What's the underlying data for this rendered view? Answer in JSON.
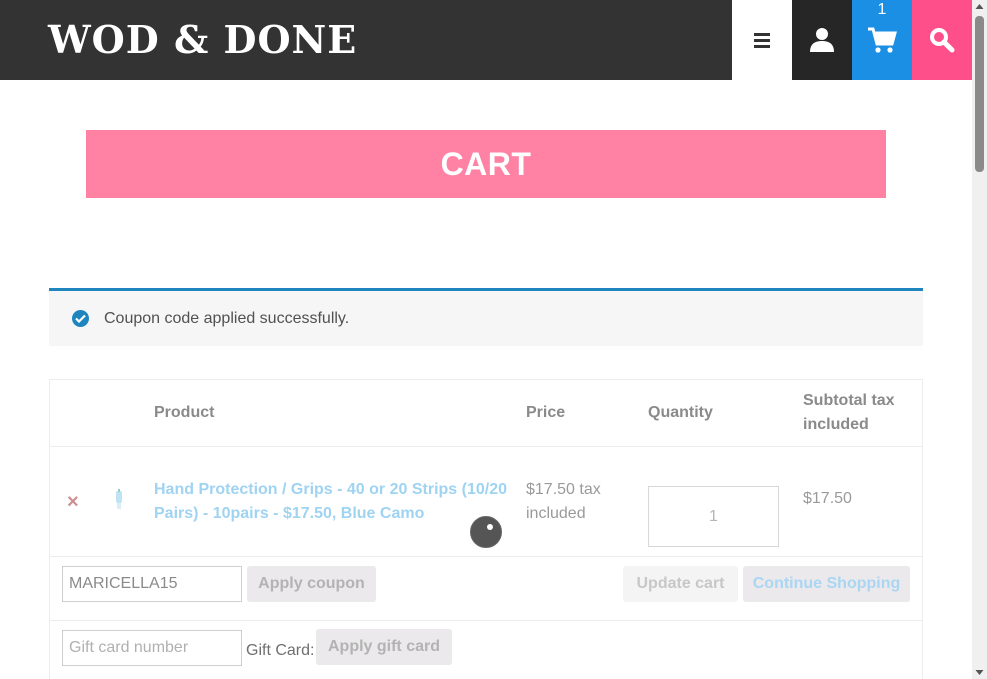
{
  "header": {
    "logo": "WOD & DONE",
    "cart_count": "1",
    "colors": {
      "bar": "#333333",
      "account": "#262626",
      "cart": "#1a8fe3",
      "search": "#ff4f8a"
    }
  },
  "page": {
    "title": "CART",
    "banner_color": "#ff82a5"
  },
  "notice": {
    "text": "Coupon code applied successfully.",
    "icon": "check-circle-icon"
  },
  "table": {
    "headers": {
      "product": "Product",
      "price": "Price",
      "quantity": "Quantity",
      "subtotal_line1": "Subtotal tax",
      "subtotal_line2": "included"
    },
    "items": [
      {
        "name": "Hand Protection / Grips - 40 or 20 Strips (10/20 Pairs) - 10pairs - $17.50, Blue Camo",
        "price_line1": "$17.50 tax",
        "price_line2": "included",
        "quantity": "1",
        "subtotal": "$17.50",
        "remove_glyph": "×"
      }
    ]
  },
  "actions": {
    "coupon_value": "MARICELLA15",
    "apply_coupon": "Apply coupon",
    "update_cart": "Update cart",
    "continue_shopping": "Continue Shopping"
  },
  "gift": {
    "placeholder": "Gift card number",
    "label": "Gift Card:",
    "apply": "Apply gift card"
  }
}
